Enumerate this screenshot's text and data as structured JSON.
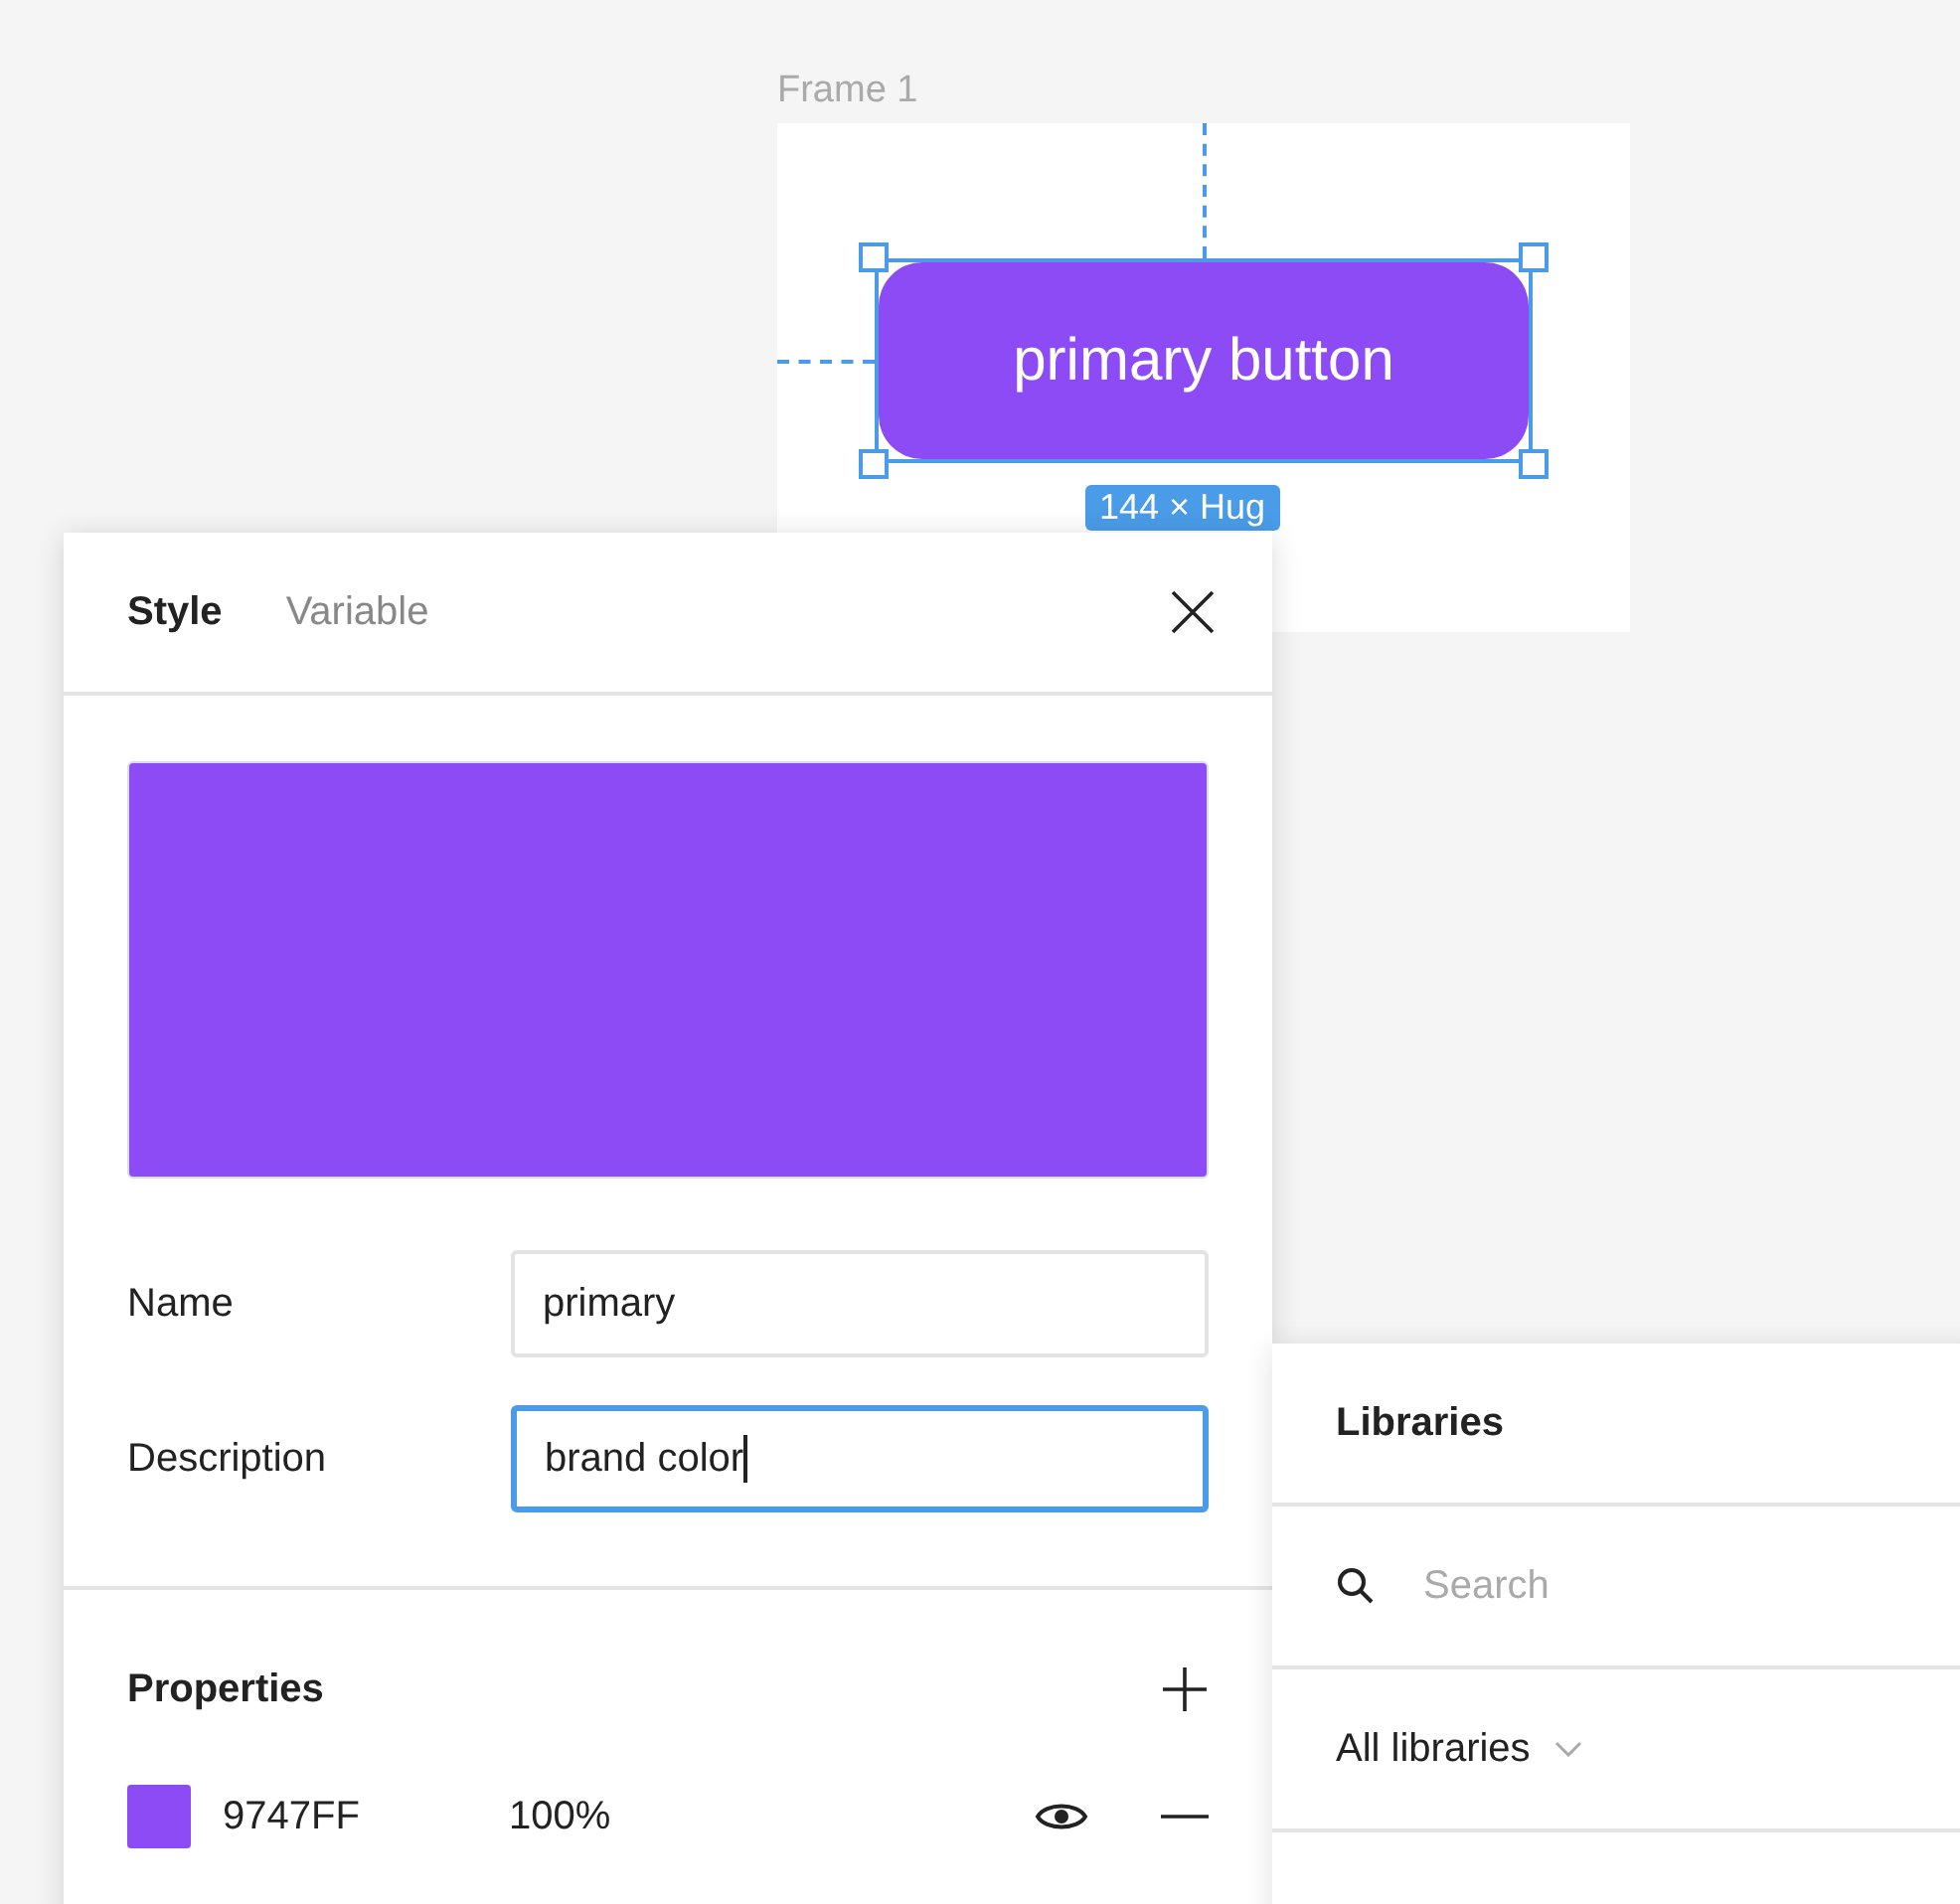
{
  "canvas": {
    "frame_title": "Frame 1",
    "button": {
      "label": "primary button",
      "selected": true
    },
    "size_label": "144 × Hug"
  },
  "style_panel": {
    "tabs": [
      {
        "label": "Style",
        "selected": true
      },
      {
        "label": "Variable",
        "selected": false
      }
    ],
    "fields": [
      {
        "label": "Name",
        "value": "primary",
        "focused": false
      },
      {
        "label": "Description",
        "value": "brand color",
        "focused": true
      }
    ],
    "properties_title": "Properties",
    "properties": [
      {
        "hex": "9747FF",
        "opacity": "100%",
        "color": "#8c4bf4",
        "visible": true
      }
    ]
  },
  "libraries_panel": {
    "title": "Libraries",
    "search": {
      "placeholder": "Search"
    },
    "filter": "All libraries"
  }
}
